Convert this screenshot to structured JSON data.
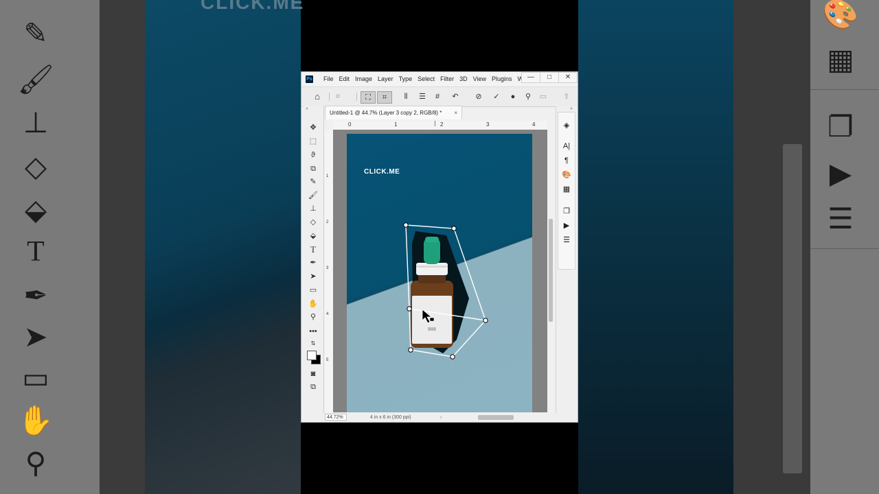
{
  "background": {
    "text": "CLICK.ME"
  },
  "window": {
    "logo": "Ps",
    "menu": [
      "File",
      "Edit",
      "Image",
      "Layer",
      "Type",
      "Select",
      "Filter",
      "3D",
      "View",
      "Plugins",
      "W"
    ],
    "controls": {
      "minimize": "—",
      "maximize": "□",
      "close": "✕"
    }
  },
  "document": {
    "tab_title": "Untitled-1 @ 44.7% (Layer 3 copy 2, RGB/8) *",
    "tab_close": "×"
  },
  "rulers": {
    "top": [
      "0",
      "1",
      "2",
      "3",
      "4"
    ],
    "left": [
      "1",
      "2",
      "3",
      "4",
      "5"
    ]
  },
  "canvas": {
    "brand_text": "CLICK.ME"
  },
  "status": {
    "zoom": "44.72%",
    "doc_info": "4 in x 6 in (300 ppi)",
    "arrow": "›"
  },
  "icons": {
    "home": "home-icon",
    "warp": "puppet-warp-icon",
    "options": [
      "transform-icon",
      "grid-icon",
      "dividers-icon",
      "rows-icon",
      "hash-icon",
      "undo-icon",
      "cancel-icon",
      "commit-icon",
      "info-icon",
      "search-icon",
      "frame-icon",
      "share-icon"
    ]
  },
  "colors": {
    "canvas_top": "#075376",
    "canvas_bottom": "#8bb3c2",
    "bottle_cap": "#1f9f7a",
    "bottle_glass": "#7a4a22"
  }
}
